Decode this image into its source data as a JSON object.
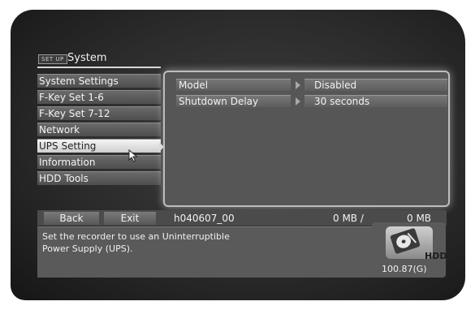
{
  "header": {
    "tag": "SET UP",
    "title": "System"
  },
  "menu": {
    "items": [
      {
        "label": "System Settings"
      },
      {
        "label": "F-Key Set 1-6"
      },
      {
        "label": "F-Key Set 7-12"
      },
      {
        "label": "Network"
      },
      {
        "label": "UPS Setting"
      },
      {
        "label": "Information"
      },
      {
        "label": "HDD Tools"
      }
    ],
    "selected": "UPS Setting"
  },
  "settings": {
    "rows": [
      {
        "label": "Model",
        "value": "Disabled"
      },
      {
        "label": "Shutdown Delay",
        "value": "30 seconds"
      }
    ]
  },
  "toolbar": {
    "back_label": "Back",
    "exit_label": "Exit",
    "filename": "h040607_00",
    "mb_used": "0 MB /",
    "mb_total": "0 MB"
  },
  "description": {
    "line1": "Set the recorder to use an Uninterruptible",
    "line2": "Power Supply (UPS)."
  },
  "hdd": {
    "label": "HDD",
    "capacity": "100.87(G)",
    "icon": "hdd-icon"
  },
  "colors": {
    "panel_glow": "#e6e6e6",
    "selected_item": "#e8e8e8",
    "background": "#2b2b2b"
  }
}
